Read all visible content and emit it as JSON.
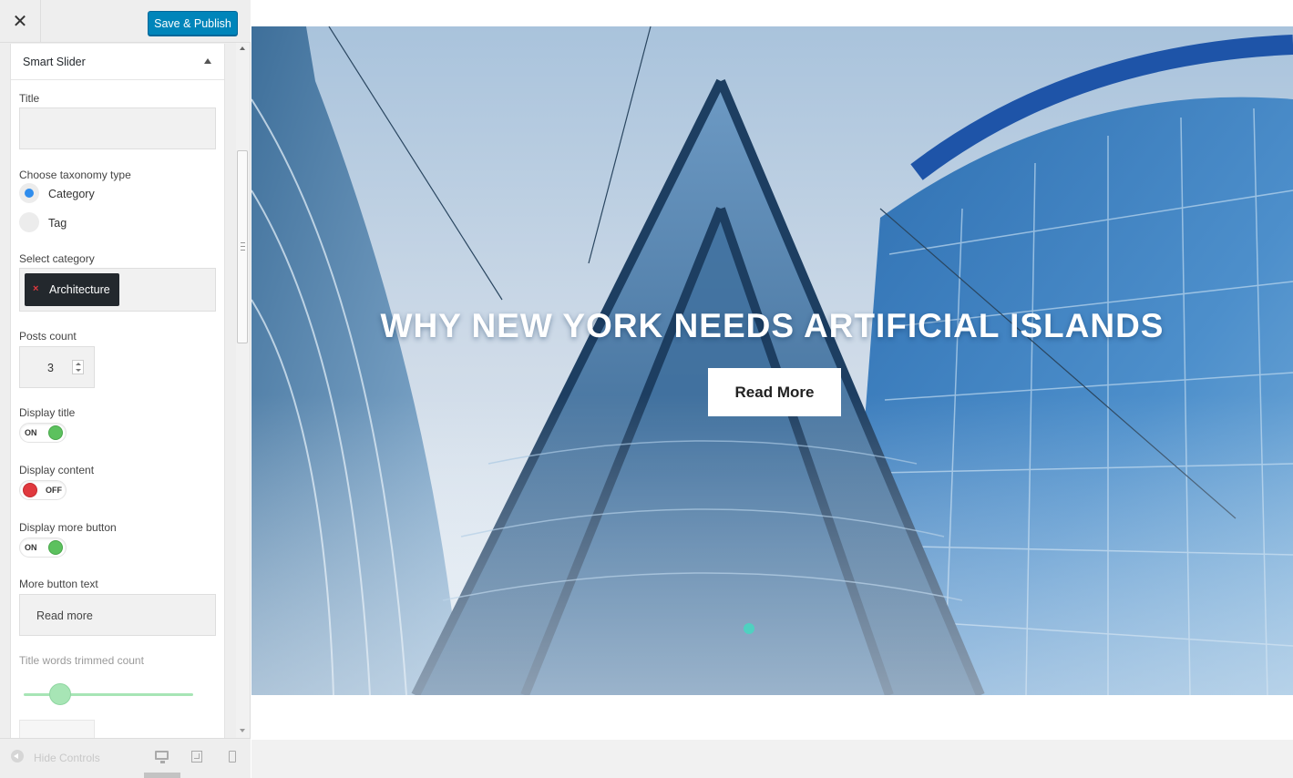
{
  "topbar": {
    "close_glyph": "✕",
    "save_label": "Save & Publish"
  },
  "panel": {
    "title": "Smart Slider",
    "title_label": "Title",
    "title_value": "",
    "taxonomy_label": "Choose taxonomy type",
    "taxonomy_options": [
      {
        "label": "Category",
        "selected": true
      },
      {
        "label": "Tag",
        "selected": false
      }
    ],
    "category_label": "Select category",
    "category_selected": "Architecture",
    "category_remove_glyph": "×",
    "posts_count_label": "Posts count",
    "posts_count_value": "3",
    "display_title_label": "Display title",
    "display_title_state": "ON",
    "display_content_label": "Display content",
    "display_content_state": "OFF",
    "display_more_label": "Display more button",
    "display_more_state": "ON",
    "more_text_label": "More button text",
    "more_text_value": "Read more",
    "trim_label": "Title words trimmed count"
  },
  "footer": {
    "hide_label": "Hide Controls",
    "active_device": "desktop"
  },
  "preview": {
    "slide_title": "WHY NEW YORK NEEDS ARTIFICIAL ISLANDS",
    "slide_button": "Read More",
    "slide_count": 1,
    "active_slide": 1
  },
  "colors": {
    "accent": "#0085ba",
    "toggle_on": "#5cc15e",
    "toggle_off": "#e0393e",
    "radio_selected": "#2f8ded",
    "slider_dot": "#4fd1c0"
  }
}
